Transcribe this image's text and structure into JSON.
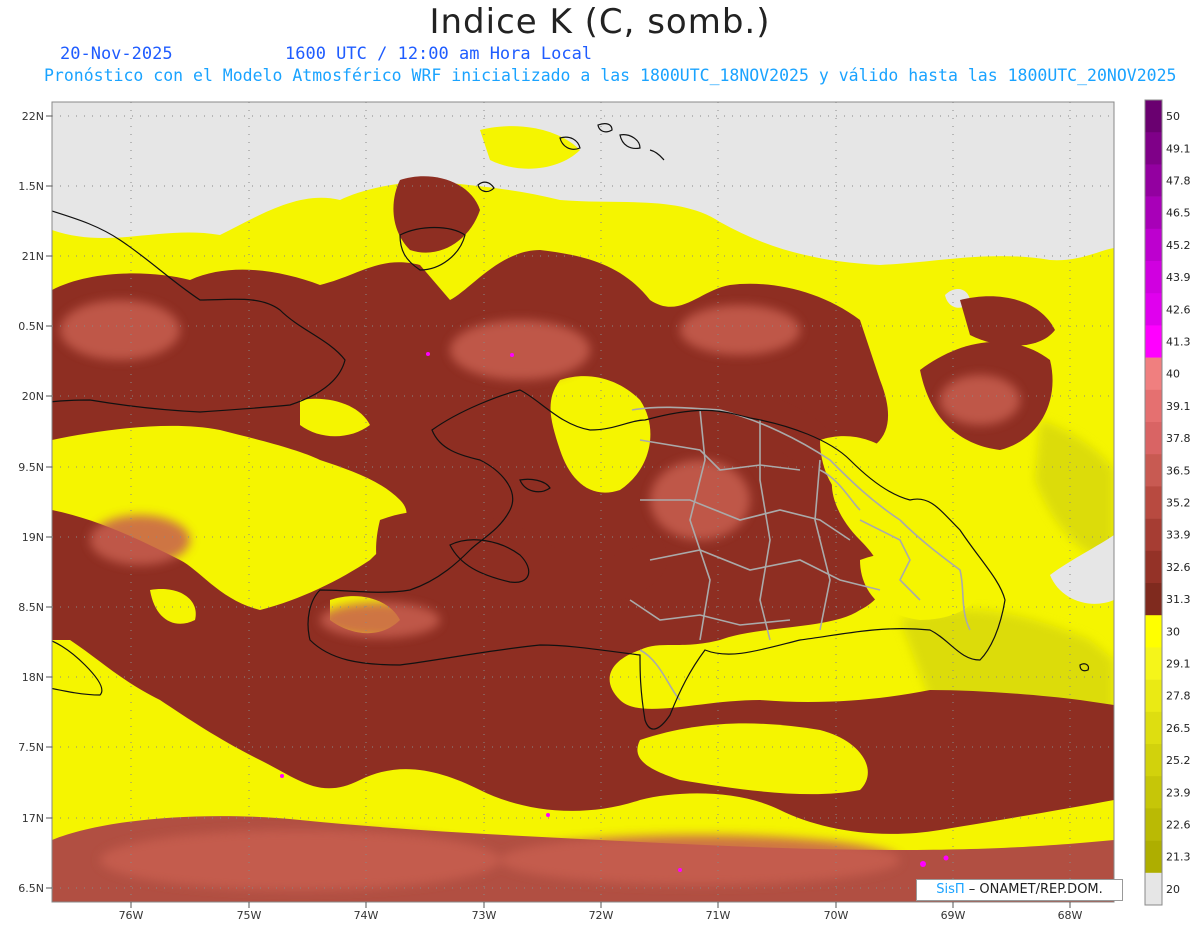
{
  "title": "Indice K (C, somb.)",
  "date": "20-Nov-2025",
  "time": "1600 UTC / 12:00 am Hora Local",
  "forecast": "Pronóstico con el Modelo Atmosférico WRF inicializado a las 1800UTC_18NOV2025 y válido hasta las  1800UTC_20NOV2025",
  "lat_labels": [
    "22N",
    "1.5N",
    "21N",
    "0.5N",
    "20N",
    "9.5N",
    "19N",
    "8.5N",
    "18N",
    "7.5N",
    "17N",
    "6.5N"
  ],
  "lon_labels": [
    "76W",
    "75W",
    "74W",
    "73W",
    "72W",
    "71W",
    "70W",
    "69W",
    "68W"
  ],
  "colorbar": {
    "levels": [
      "50",
      "49.1",
      "47.8",
      "46.5",
      "45.2",
      "43.9",
      "42.6",
      "41.3",
      "40",
      "39.1",
      "37.8",
      "36.5",
      "35.2",
      "33.9",
      "32.6",
      "31.3",
      "30",
      "29.1",
      "27.8",
      "26.5",
      "25.2",
      "23.9",
      "22.6",
      "21.3",
      "20"
    ],
    "colors": [
      "#6a0070",
      "#7f0088",
      "#9300a0",
      "#a800b8",
      "#bd00cf",
      "#d000e0",
      "#e000ee",
      "#ff00ff",
      "#f07f7f",
      "#e57070",
      "#d96464",
      "#c85a52",
      "#b84a40",
      "#a63d33",
      "#943227",
      "#7f2a1e",
      "#ffff00",
      "#f5f51a",
      "#eaea14",
      "#dede10",
      "#d2d20c",
      "#c6c608",
      "#baba04",
      "#aeae00",
      "#e6e6e6"
    ]
  },
  "credit": {
    "sis": "SisΠ",
    "rest": " – ONAMET/REP.DOM."
  }
}
